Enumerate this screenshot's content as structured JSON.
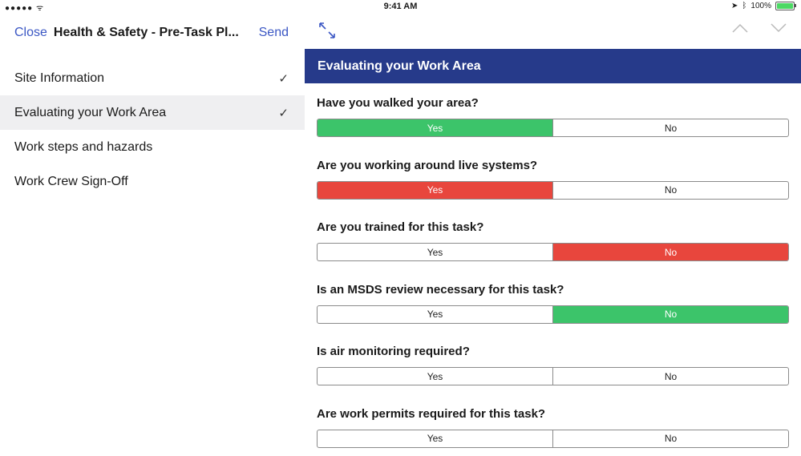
{
  "status_bar": {
    "signal": "●●●●● ᯤ",
    "time": "9:41 AM",
    "battery_text": "100%",
    "battery_level": 1.0
  },
  "nav": {
    "close_label": "Close",
    "title": "Health & Safety - Pre-Task Pl...",
    "send_label": "Send"
  },
  "sections": [
    {
      "label": "Site Information",
      "checked": true,
      "active": false
    },
    {
      "label": "Evaluating your Work Area",
      "checked": true,
      "active": true
    },
    {
      "label": "Work steps and hazards",
      "checked": false,
      "active": false
    },
    {
      "label": "Work Crew Sign-Off",
      "checked": false,
      "active": false
    }
  ],
  "check_glyph": "✓",
  "section_header": "Evaluating your Work Area",
  "questions": [
    {
      "text": "Have you walked your area?",
      "yes": "Yes",
      "no": "No",
      "selected": "yes",
      "color": "green"
    },
    {
      "text": "Are you working around live systems?",
      "yes": "Yes",
      "no": "No",
      "selected": "yes",
      "color": "red"
    },
    {
      "text": "Are you trained for this task?",
      "yes": "Yes",
      "no": "No",
      "selected": "no",
      "color": "red"
    },
    {
      "text": "Is an MSDS review necessary for this task?",
      "yes": "Yes",
      "no": "No",
      "selected": "no",
      "color": "green"
    },
    {
      "text": "Is air monitoring required?",
      "yes": "Yes",
      "no": "No",
      "selected": null,
      "color": null
    },
    {
      "text": "Are work permits required for this task?",
      "yes": "Yes",
      "no": "No",
      "selected": null,
      "color": null
    }
  ],
  "colors": {
    "accent_blue": "#3b57c4",
    "header_navy": "#263a8a",
    "selected_green": "#3cc46a",
    "selected_red": "#e8463d",
    "battery_green": "#4cd964"
  }
}
